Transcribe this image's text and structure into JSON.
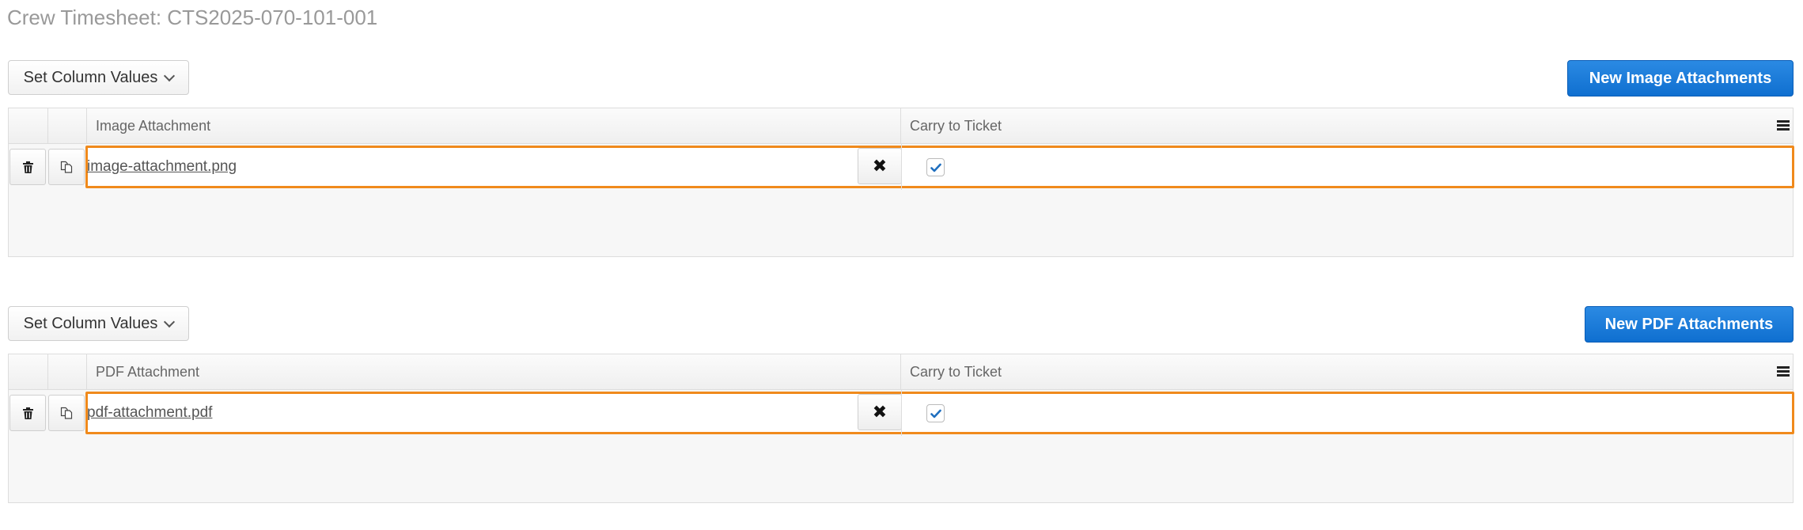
{
  "page_title": "Crew Timesheet: CTS2025-070-101-001",
  "sections": [
    {
      "set_column_values_label": "Set Column Values",
      "new_button_label": "New Image Attachments",
      "columns": {
        "attachment": "Image Attachment",
        "carry": "Carry to Ticket"
      },
      "rows": [
        {
          "file": "image-attachment.png",
          "carry_to_ticket": true
        }
      ]
    },
    {
      "set_column_values_label": "Set Column Values",
      "new_button_label": "New PDF Attachments",
      "columns": {
        "attachment": "PDF Attachment",
        "carry": "Carry to Ticket"
      },
      "rows": [
        {
          "file": "pdf-attachment.pdf",
          "carry_to_ticket": true
        }
      ]
    }
  ],
  "icons": {
    "delete": "trash-icon",
    "copy": "copy-icon",
    "clear": "close-icon",
    "menu": "menu-icon",
    "check": "checkmark-icon",
    "dropdown": "chevron-down-icon"
  },
  "colors": {
    "primary_button": "#1274d8",
    "highlight_border": "#f08a1c",
    "checkmark": "#1f6fbf",
    "title_text": "#999999"
  }
}
